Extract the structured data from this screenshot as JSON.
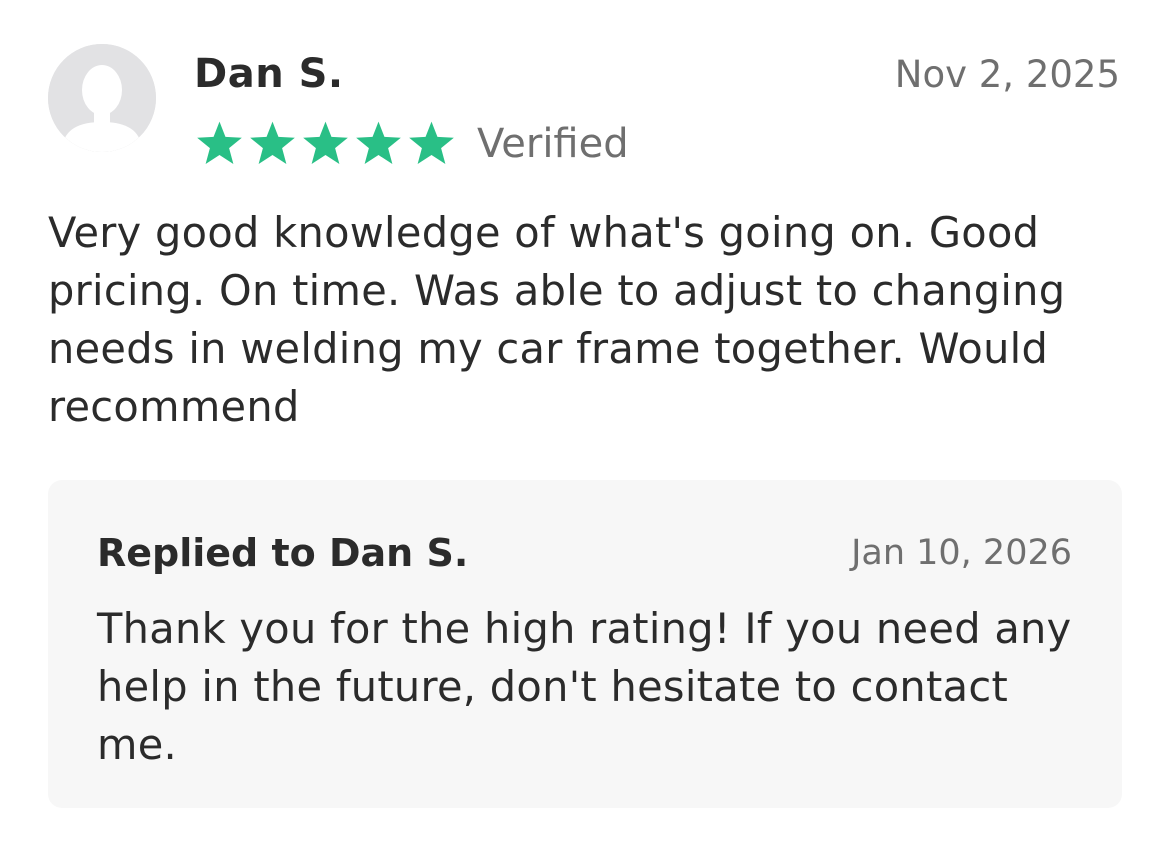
{
  "review": {
    "reviewer_name": "Dan S.",
    "date": "Nov 2, 2025",
    "rating": 5,
    "rating_max": 5,
    "verified_label": "Verified",
    "text": "Very good knowledge of what's going on. Good pricing. On time. Was able to adjust to changing needs in welding my car frame together. Would recommend",
    "avatar_icon": "default-user-avatar-icon"
  },
  "reply": {
    "title": "Replied to Dan S.",
    "date": "Jan 10, 2026",
    "text": "Thank you for the high rating! If you need any help in the future, don't hesitate to contact me."
  },
  "colors": {
    "star": "#29bf86",
    "avatar_bg": "#e2e2e4",
    "avatar_silhouette": "#ffffff",
    "reply_bg": "#f7f7f7",
    "muted_text": "#6f6f6f",
    "primary_text": "#2b2b2b"
  }
}
